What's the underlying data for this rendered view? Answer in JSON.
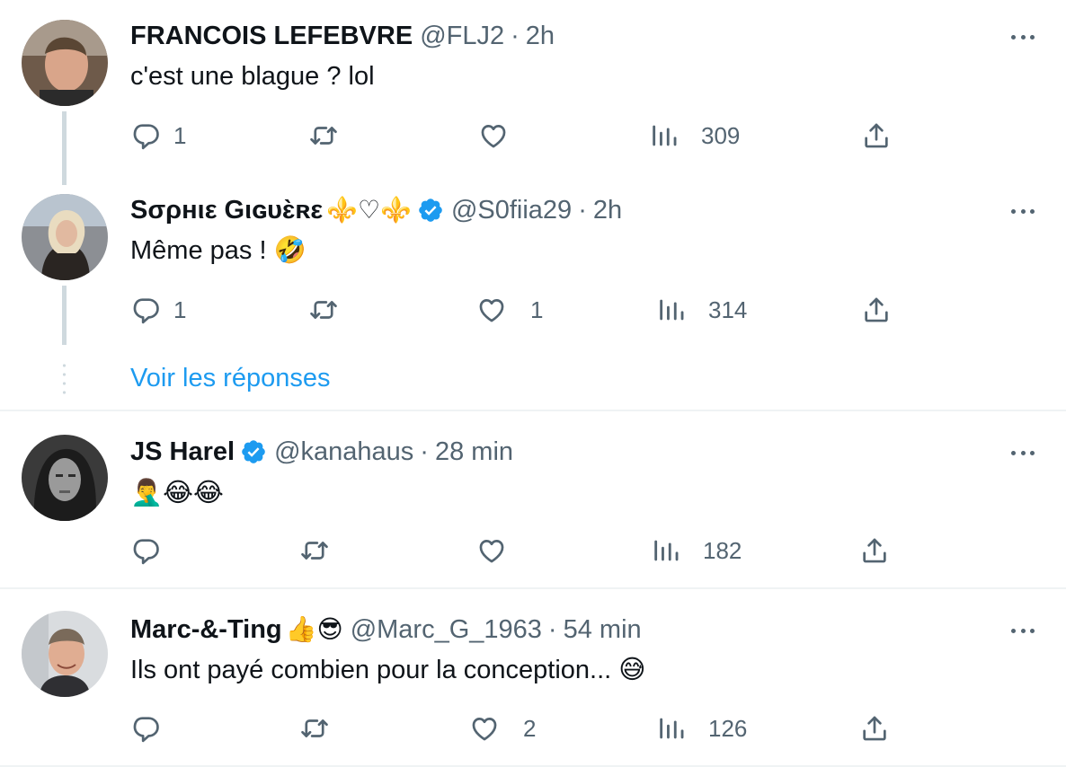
{
  "tweets": [
    {
      "name": "FRANCOIS LEFEBVRE",
      "handle": "@FLJ2",
      "separator": "·",
      "time": "2h",
      "text": "c'est une blague ? lol",
      "replies": "1",
      "retweets": "",
      "likes": "",
      "views": "309",
      "verified": false
    },
    {
      "name": "Sσρнιε Gιɢυɛ̀ʀε",
      "name_emoji": "⚜️♡⚜️",
      "handle": "@S0fiia29",
      "separator": "·",
      "time": "2h",
      "text": "Même pas ! 🤣",
      "replies": "1",
      "retweets": "",
      "likes": "1",
      "views": "314",
      "verified": true
    },
    {
      "name": "JS Harel",
      "handle": "@kanahaus",
      "separator": "·",
      "time": "28 min",
      "text": "🤦‍♂️😂😂",
      "replies": "",
      "retweets": "",
      "likes": "",
      "views": "182",
      "verified": true
    },
    {
      "name": "Marc-&-Ting",
      "name_emoji": "👍😎",
      "handle": "@Marc_G_1963",
      "separator": "·",
      "time": "54 min",
      "text": "Ils ont payé combien pour la conception... 😅",
      "replies": "",
      "retweets": "",
      "likes": "2",
      "views": "126",
      "verified": false
    }
  ],
  "show_replies_label": "Voir les réponses",
  "colors": {
    "text_primary": "#0f1419",
    "text_secondary": "#536471",
    "link_blue": "#1d9bf0",
    "verified_blue": "#1d9bf0",
    "thread_line": "#cfd9de",
    "divider": "#eff3f4"
  },
  "icons": [
    "reply-icon",
    "retweet-icon",
    "like-icon",
    "views-icon",
    "share-icon",
    "more-icon",
    "verified-badge-icon"
  ]
}
